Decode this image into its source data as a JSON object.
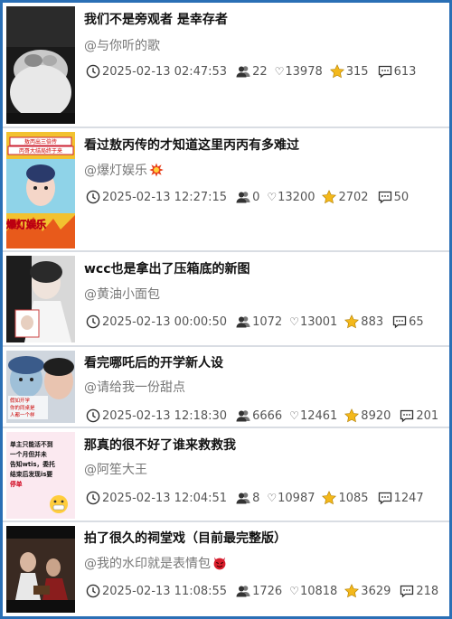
{
  "colors": {
    "frame": "#2a6fb5",
    "star": "#f3b81b",
    "fire": "#e8401b"
  },
  "items": [
    {
      "title": "我们不是旁观者 是幸存者",
      "author": "@与你听的歌",
      "author_emoji": "",
      "time": "2025-02-13 02:47:53",
      "users": "22",
      "likes": "13978",
      "stars": "315",
      "comments": "613",
      "thumb_text": []
    },
    {
      "title": "看过敖丙传的才知道这里丙丙有多难过",
      "author": "@爆灯娱乐",
      "author_emoji": "collision-icon",
      "time": "2025-02-13 12:27:15",
      "users": "0",
      "likes": "13200",
      "stars": "2702",
      "comments": "50",
      "thumb_text": [
        "敖丙出三倍传",
        "丙哥大结局终于来",
        "爆灯娱乐"
      ]
    },
    {
      "title": "wcc也是拿出了压箱底的新图",
      "author": "@黄油小面包",
      "author_emoji": "",
      "time": "2025-02-13 00:00:50",
      "users": "1072",
      "likes": "13001",
      "stars": "883",
      "comments": "65",
      "thumb_text": []
    },
    {
      "title": "看完哪吒后的开学新人设",
      "author": "@请给我一份甜点",
      "author_emoji": "",
      "time": "2025-02-13 12:18:30",
      "users": "6666",
      "likes": "12461",
      "stars": "8920",
      "comments": "201",
      "thumb_text": [
        "假如开学",
        "你的同桌是",
        "人都一个样"
      ]
    },
    {
      "title": "那真的很不好了谁来救救我",
      "author": "@阿笙大王",
      "author_emoji": "",
      "time": "2025-02-13 12:04:51",
      "users": "8",
      "likes": "10987",
      "stars": "1085",
      "comments": "1247",
      "thumb_text": [
        "单主只能活不到",
        "一个月但并未",
        "告知wtis，委托",
        "结束后发现is要",
        "停单"
      ]
    },
    {
      "title": "拍了很久的祠堂戏（目前最完整版）",
      "author": "@我的水印就是表情包",
      "author_emoji": "devil-icon",
      "time": "2025-02-13 11:08:55",
      "users": "1726",
      "likes": "10818",
      "stars": "3629",
      "comments": "218",
      "thumb_text": []
    }
  ]
}
